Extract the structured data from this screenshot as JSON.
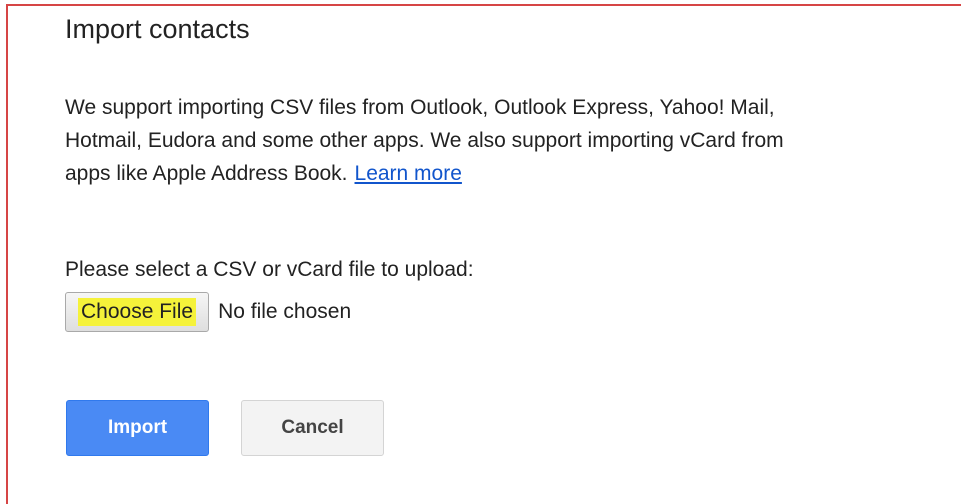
{
  "dialog": {
    "title": "Import contacts",
    "description_lines": [
      "We support importing CSV files from Outlook, Outlook Express, Yahoo! Mail,",
      "Hotmail, Eudora and some other apps. We also support importing vCard from",
      "apps like Apple Address Book."
    ],
    "learn_more_link": "Learn more",
    "upload_label": "Please select a CSV or vCard file to upload:",
    "file_input": {
      "button_label": "Choose File",
      "status": "No file chosen",
      "highlight_color": "#f5f23a"
    },
    "buttons": {
      "import_label": "Import",
      "cancel_label": "Cancel"
    }
  },
  "colors": {
    "frame_border": "#d64545",
    "import_button": "#4a8af4",
    "link": "#1155cc"
  }
}
